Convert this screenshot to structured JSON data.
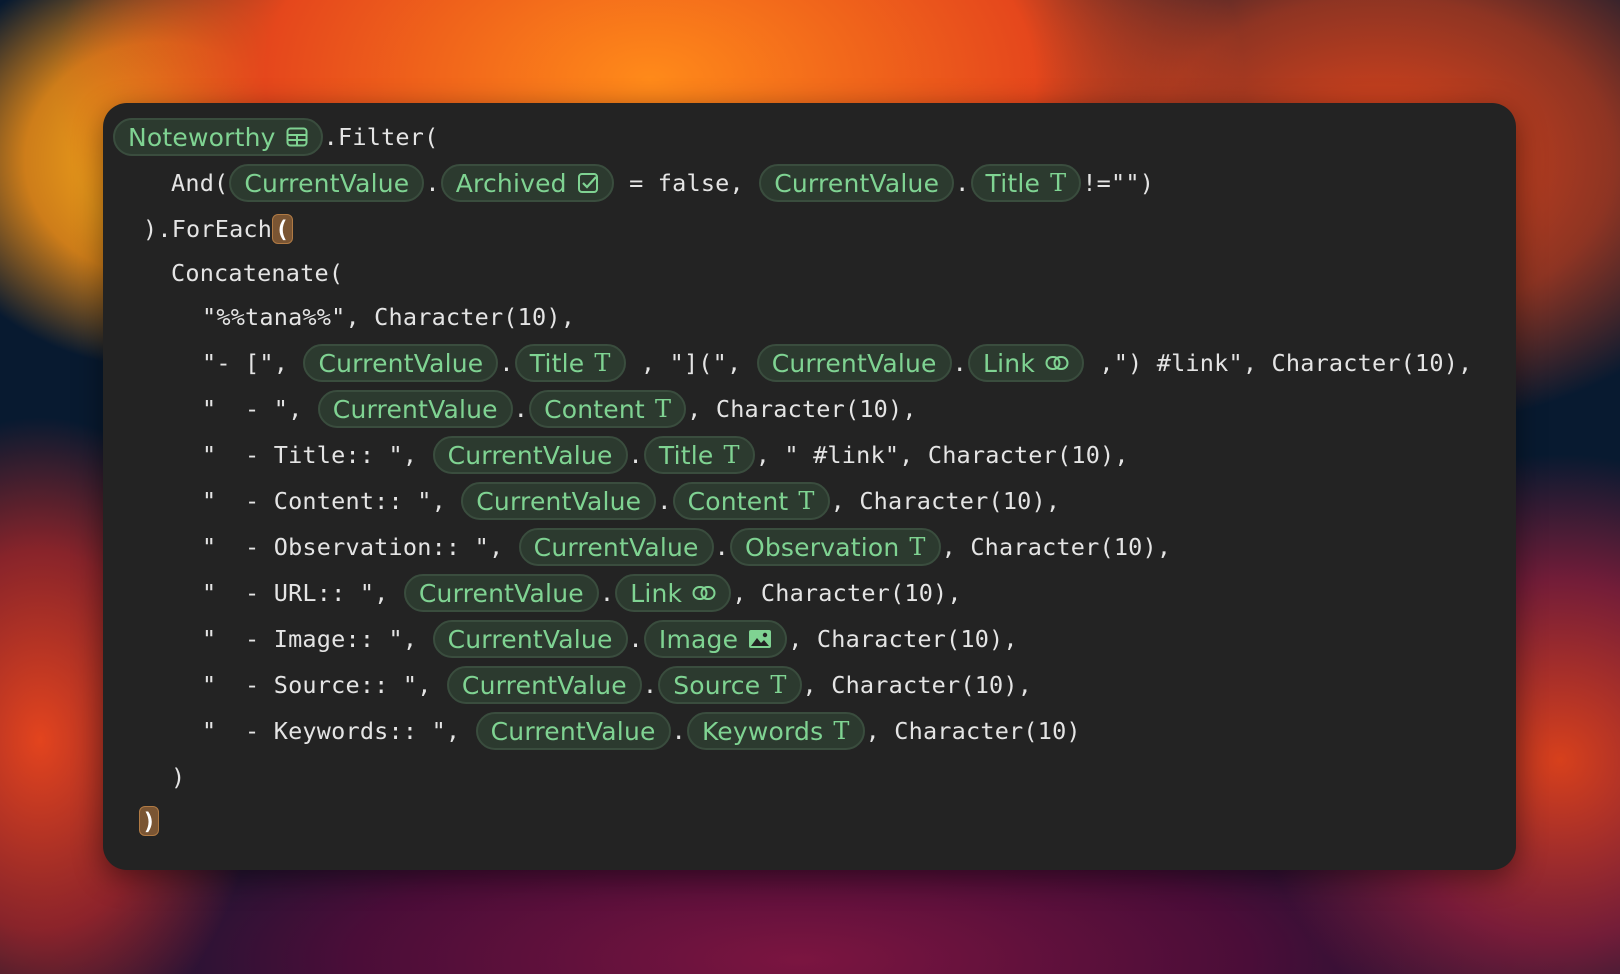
{
  "formula": {
    "fields": {
      "noteworthy": "Noteworthy",
      "current_value": "CurrentValue",
      "archived": "Archived",
      "title": "Title",
      "link": "Link",
      "content": "Content",
      "observation": "Observation",
      "url_field": "Link",
      "image": "Image",
      "source": "Source",
      "keywords": "Keywords"
    },
    "text": {
      "filter": ".Filter(",
      "and_open": "And(",
      "dot": ".",
      "eq_false": " = false, ",
      "neq_empty": "!=\"\")",
      "close_foreach": ").ForEach",
      "open_paren": "(",
      "concatenate": "Concatenate(",
      "tana_line": "\"%%tana%%\", Character(10),",
      "bullet_open": "\"- [\", ",
      "bracket_mid": " , \"](\", ",
      "link_tail": " ,\") #link\", Character(10),",
      "dash_open": "\"  - \", ",
      "char10": ", Character(10),",
      "title_open": "\"  - Title:: \", ",
      "title_tail": ", \" #link\", Character(10),",
      "content_open": "\"  - Content:: \", ",
      "observation_open": "\"  - Observation:: \", ",
      "url_open": "\"  - URL:: \", ",
      "image_open": "\"  - Image:: \", ",
      "source_open": "\"  - Source:: \", ",
      "keywords_open": "\"  - Keywords:: \", ",
      "char10_end": ", Character(10)",
      "close_concat": ")",
      "close_paren": ")"
    },
    "icons": {
      "table": "table-icon",
      "checkbox": "checkbox-icon",
      "text_type": "text-type-icon",
      "link": "link-icon",
      "image": "image-icon"
    },
    "colors": {
      "chip_text": "#7fd392",
      "chip_bg": "#2c3a2f",
      "code_text": "#e4e4e4",
      "editor_bg": "#232323",
      "highlight_paren": "#7a5533"
    }
  }
}
